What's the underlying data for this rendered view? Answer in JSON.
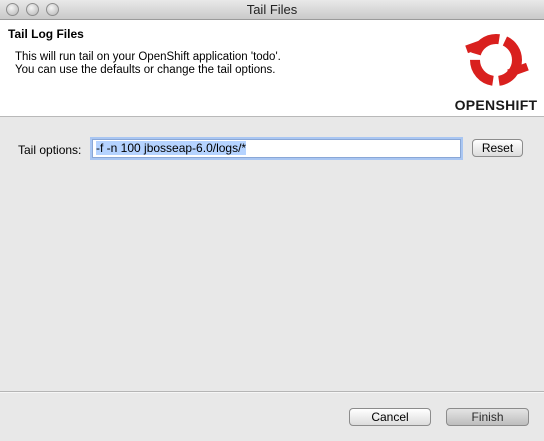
{
  "window": {
    "title": "Tail Files"
  },
  "header": {
    "title": "Tail Log Files",
    "description_line1": "This will run tail on your OpenShift application 'todo'.",
    "description_line2": "You can use the defaults or change the tail options.",
    "logo_text": "OPENSHIFT"
  },
  "form": {
    "tail_options_label": "Tail options:",
    "tail_options_value": "-f -n 100 jbosseap-6.0/logs/*",
    "reset_label": "Reset"
  },
  "footer": {
    "cancel_label": "Cancel",
    "finish_label": "Finish"
  },
  "colors": {
    "logo_red": "#d9201e",
    "selection": "#b5d3ff",
    "focus_ring": "#a9c6f2"
  }
}
